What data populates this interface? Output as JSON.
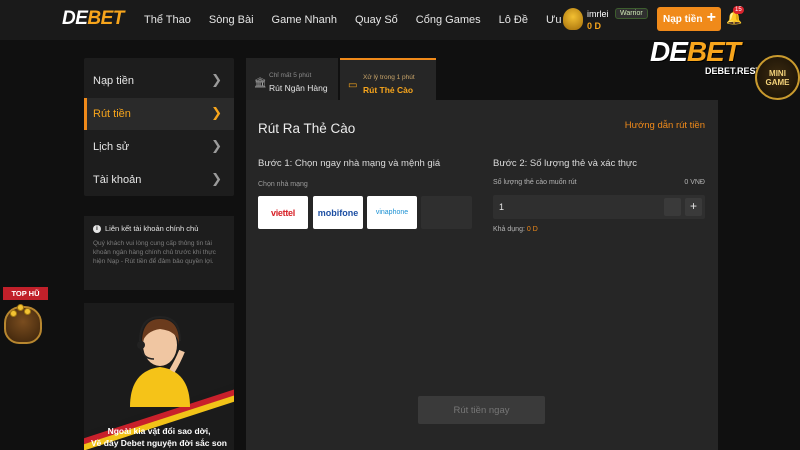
{
  "header": {
    "logo_main": "DE",
    "logo_accent": "BET",
    "nav": [
      "Thể Thao",
      "Sòng Bài",
      "Game Nhanh",
      "Quay Số",
      "Cổng Games",
      "Lô Đề",
      "Ưu Đãi"
    ],
    "user": {
      "name": "imrlei",
      "badge": "Warrior",
      "balance": "0 D"
    },
    "deposit_label": "Nạp tiền",
    "notification_count": "15"
  },
  "sidebar": {
    "items": [
      {
        "label": "Nạp tiền",
        "active": false
      },
      {
        "label": "Rút tiền",
        "active": true
      },
      {
        "label": "Lịch sử",
        "active": false
      },
      {
        "label": "Tài khoản",
        "active": false
      }
    ]
  },
  "info": {
    "title": "Liên kết tài khoản chính chủ",
    "text": "Quý khách vui lòng cung cấp thông tin tài khoản ngân hàng chính chủ trước khi thực hiện Nạp - Rút tiền để đảm bảo quyền lợi."
  },
  "promo": {
    "line1": "Ngoài kia vật đổi sao dời,",
    "line2": "Về đây Debet nguyện đời sắc son"
  },
  "tabs": [
    {
      "sub": "Chỉ mất 5 phút",
      "label": "Rút Ngân Hàng",
      "active": false
    },
    {
      "sub": "Xử lý trong 1 phút",
      "label": "Rút Thẻ Cào",
      "active": true
    }
  ],
  "panel": {
    "title": "Rút Ra Thẻ Cào",
    "guide_link": "Hướng dẫn rút tiền",
    "step1": "Bước 1: Chọn ngay nhà mạng và mệnh giá",
    "step2": "Bước 2: Số lượng thẻ và xác thực",
    "carrier_label": "Chọn nhà mạng",
    "carriers": [
      "viettel",
      "mobifone",
      "vinaphone"
    ],
    "quantity_label": "Số lượng thẻ cào muốn rút",
    "quantity_amount": "0 VNĐ",
    "quantity_value": "1",
    "available_label": "Khả dụng:",
    "available_value": "0 D",
    "withdraw_button": "Rút tiền ngay"
  },
  "overlays": {
    "watermark_main": "DE",
    "watermark_accent": "BET",
    "watermark_url": "DEBET.REST",
    "minigame_line1": "MINI",
    "minigame_line2": "GAME",
    "tophu_label": "TOP HŨ"
  },
  "colors": {
    "accent": "#f08a1a",
    "background": "#101010",
    "panel": "#262626"
  }
}
